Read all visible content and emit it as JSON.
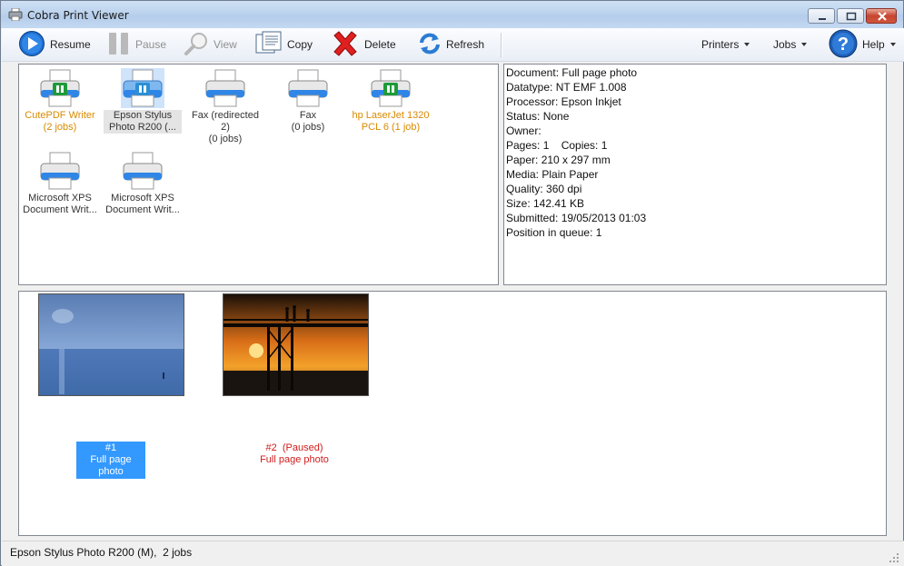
{
  "window": {
    "title": "Cobra Print Viewer"
  },
  "toolbar": {
    "resume": "Resume",
    "pause": "Pause",
    "view": "View",
    "copy": "Copy",
    "delete": "Delete",
    "refresh": "Refresh",
    "printers": "Printers",
    "jobs": "Jobs",
    "help": "Help"
  },
  "printers": [
    {
      "line1": "CutePDF Writer",
      "line2": "(2 jobs)",
      "status": "paused",
      "color": "orange"
    },
    {
      "line1": "Epson Stylus",
      "line2": "Photo R200 (...",
      "status": "paused",
      "selected": true
    },
    {
      "line1": "Fax (redirected 2)",
      "line2": "(0 jobs)",
      "status": "normal"
    },
    {
      "line1": "Fax",
      "line2": "(0 jobs)",
      "status": "normal"
    },
    {
      "line1": "hp LaserJet 1320",
      "line2": "PCL 6 (1 job)",
      "status": "paused",
      "color": "orange"
    },
    {
      "line1": "Microsoft XPS",
      "line2": "Document Writ...",
      "status": "normal"
    },
    {
      "line1": "Microsoft XPS",
      "line2": "Document Writ...",
      "status": "normal"
    }
  ],
  "details": [
    "Document: Full page photo",
    "Datatype: NT EMF 1.008",
    "Processor: Epson Inkjet",
    "Status: None",
    "Owner:",
    "Pages: 1    Copies: 1",
    "Paper: 210 x 297 mm",
    "Media: Plain Paper",
    "Quality: 360 dpi",
    "Size: 142.41 KB",
    "Submitted: 19/05/2013 01:03",
    "Position in queue: 1"
  ],
  "jobs": [
    {
      "number": "#1",
      "title": "Full page photo",
      "selected": true
    },
    {
      "number": "#2  (Paused)",
      "title": "Full page photo",
      "paused": true
    }
  ],
  "statusbar": {
    "text": "Epson Stylus Photo R200 (M),  2 jobs"
  },
  "colors": {
    "accent": "#3399ff",
    "paused_text": "#d21c1c",
    "orange_label": "#d98a00"
  }
}
